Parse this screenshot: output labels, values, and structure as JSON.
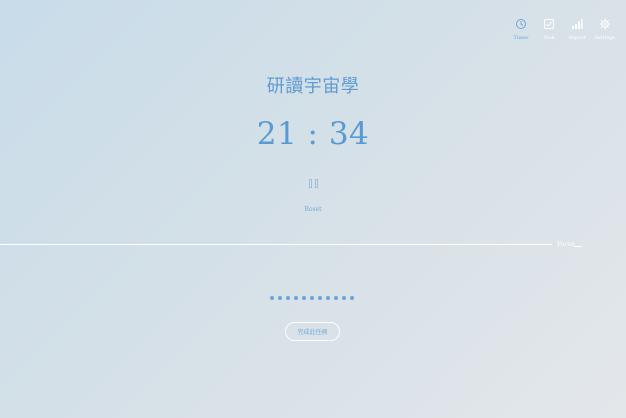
{
  "nav": {
    "items": [
      {
        "label": "Timer",
        "icon": "clock-icon",
        "active": true
      },
      {
        "label": "Task",
        "icon": "task-check-icon",
        "active": false
      },
      {
        "label": "Report",
        "icon": "signal-bars-icon",
        "active": false
      },
      {
        "label": "Settings",
        "icon": "gear-icon",
        "active": false
      }
    ]
  },
  "main": {
    "title": "研讀宇宙學",
    "timer": "21 : 34",
    "reset_label": "Reset",
    "pause_icon": "pause-icon"
  },
  "progress": {
    "mode_label": "Focus",
    "fraction_complete": 0.88
  },
  "sessions": {
    "count": 11
  },
  "finish_button": {
    "label": "完成此任務"
  },
  "colors": {
    "accent": "#5a9ad3",
    "active_nav": "#72a6d6",
    "dot": "#6aa4db",
    "line": "#ffffff"
  }
}
